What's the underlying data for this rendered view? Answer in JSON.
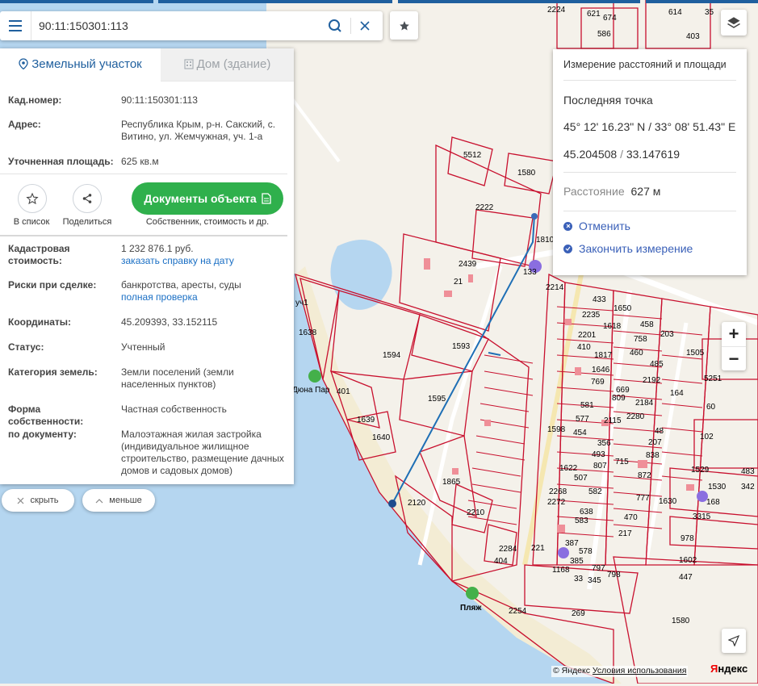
{
  "search": {
    "value": "90:11:150301:113"
  },
  "tabs": {
    "land": "Земельный участок",
    "house": "Дом (здание)"
  },
  "info": {
    "cad_label": "Кад.номер:",
    "cad_value": "90:11:150301:113",
    "addr_label": "Адрес:",
    "addr_value": "Республика Крым, р-н. Сакский, с. Витино, ул. Жемчужная, уч. 1-а",
    "area_label": "Уточненная площадь:",
    "area_value": "625 кв.м",
    "tolist": "В список",
    "share": "Поделиться",
    "docs_button": "Документы объекта",
    "docs_sub": "Собственник, стоимость и др.",
    "cost_label": "Кадастровая стоимость:",
    "cost_value": "1 232 876.1 руб.",
    "cost_link": "заказать справку на дату",
    "risk_label": "Риски при сделке:",
    "risk_value": "банкротства, аресты, суды",
    "risk_link": "полная проверка",
    "coord_label": "Координаты:",
    "coord_value": "45.209393, 33.152115",
    "status_label": "Статус:",
    "status_value": "Учтенный",
    "cat_label": "Категория земель:",
    "cat_value": "Земли поселений (земли населенных пунктов)",
    "own_label": "Форма собственности:",
    "own_value": "Частная собственность",
    "doc_label": "по документу:",
    "doc_value": "Малоэтажная жилая застройка (индивидуальное жилищное строительство, размещение дачных домов и садовых домов)"
  },
  "pills": {
    "hide": "скрыть",
    "less": "меньше"
  },
  "measure": {
    "title": "Измерение расстояний и площади",
    "last_point": "Последняя точка",
    "dms": "45° 12' 16.23\" N / 33° 08' 51.43\" E",
    "dec_lat": "45.204508",
    "dec_sep": "/",
    "dec_lon": "33.147619",
    "dist_label": "Расстояние",
    "dist_value": "627 м",
    "cancel": "Отменить",
    "finish": "Закончить измерение"
  },
  "map": {
    "labels": [
      "2224",
      "621",
      "674",
      "586",
      "614",
      "35",
      "403",
      "5512",
      "1580",
      "2222",
      "1810",
      "133",
      "21",
      "2214",
      "2439",
      "1638",
      "1594",
      "1593",
      "401",
      "1595",
      "1639",
      "1640",
      "1865",
      "2120",
      "2210",
      "2284",
      "404",
      "221",
      "433",
      "2235",
      "1650",
      "1618",
      "458",
      "203",
      "758",
      "460",
      "485",
      "1505",
      "2201",
      "410",
      "1817",
      "1646",
      "769",
      "669",
      "2192",
      "809",
      "2184",
      "581",
      "2115",
      "2280",
      "577",
      "1598",
      "454",
      "356",
      "493",
      "807",
      "1622",
      "507",
      "2268",
      "2272",
      "638",
      "583",
      "582",
      "777",
      "470",
      "217",
      "387",
      "578",
      "1168",
      "385",
      "797",
      "798",
      "33",
      "345",
      "2254",
      "269",
      "5251",
      "60",
      "102",
      "48",
      "207",
      "838",
      "1529",
      "483",
      "1530",
      "342",
      "1630",
      "168",
      "3315",
      "978",
      "1602",
      "447",
      "1580",
      "715",
      "872",
      "164"
    ],
    "poi_dune": "Дюна Пар",
    "poi_beach": "Пляж",
    "street_ch": "уч1",
    "copyright": "© Яндекс",
    "terms": "Условия использования",
    "brand_ya": "Я",
    "brand_rest": "ндекс"
  },
  "colors": {
    "accent": "#1f5f9e",
    "green": "#2fb04c",
    "parcel": "#c8102e",
    "water": "#b5d6f0",
    "link": "#1a6fc4"
  }
}
